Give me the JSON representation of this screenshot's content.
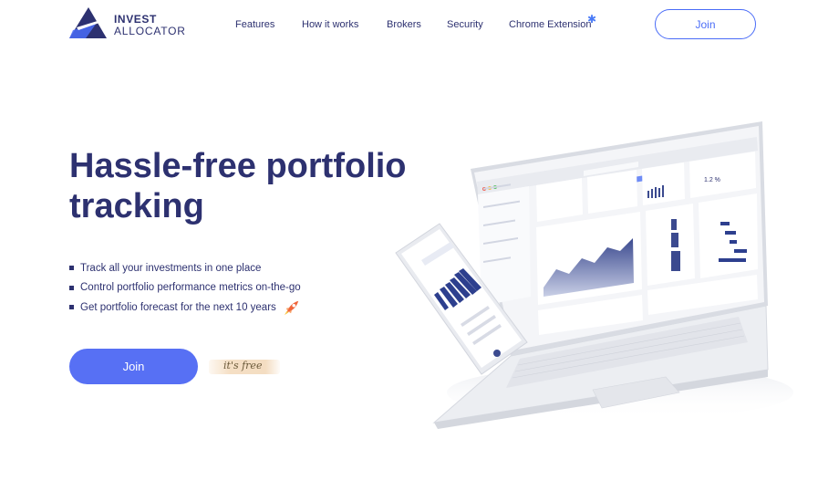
{
  "brand": {
    "name_line1": "INVEST",
    "name_line2": "ALLOCATOR"
  },
  "nav": {
    "items": [
      "Features",
      "How it works",
      "Brokers",
      "Security",
      "Chrome Extension"
    ],
    "join_label": "Join"
  },
  "hero": {
    "title_line1": "Hassle-free portfolio",
    "title_line2": "tracking",
    "bullets": [
      "Track all your investments in one place",
      "Control portfolio performance metrics on-the-go",
      "Get portfolio forecast for the next 10 years"
    ],
    "join_label": "Join",
    "free_label": "it's free"
  },
  "colors": {
    "navy": "#2d3170",
    "accent": "#5770f4",
    "free_highlight": "#f4ddc2"
  },
  "icons": {
    "rocket": "rocket-icon",
    "star": "sparkle-icon"
  }
}
